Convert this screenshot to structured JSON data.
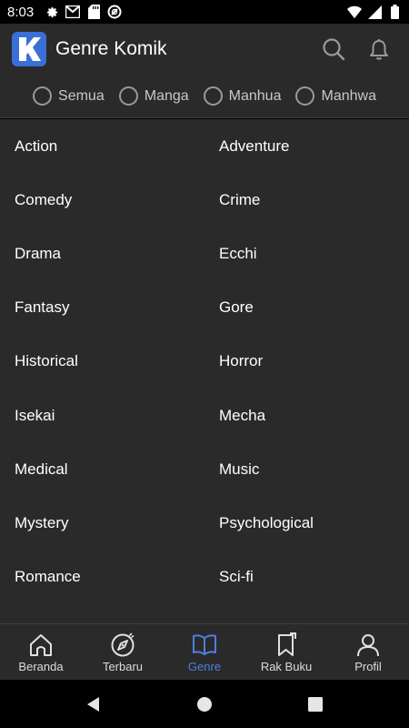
{
  "status_bar": {
    "time": "8:03",
    "left_icons": [
      "gear-icon",
      "gmail-icon",
      "sd-card-icon",
      "vpn-icon"
    ],
    "right_icons": [
      "wifi-icon",
      "signal-icon",
      "battery-icon"
    ]
  },
  "app_bar": {
    "logo_letter": "K",
    "title": "Genre Komik",
    "actions": [
      "search-icon",
      "bell-icon"
    ]
  },
  "filters": [
    {
      "label": "Semua",
      "selected": false
    },
    {
      "label": "Manga",
      "selected": false
    },
    {
      "label": "Manhua",
      "selected": false
    },
    {
      "label": "Manhwa",
      "selected": false
    }
  ],
  "genres": [
    [
      "Action",
      "Adventure"
    ],
    [
      "Comedy",
      "Crime"
    ],
    [
      "Drama",
      "Ecchi"
    ],
    [
      "Fantasy",
      "Gore"
    ],
    [
      "Historical",
      "Horror"
    ],
    [
      "Isekai",
      "Mecha"
    ],
    [
      "Medical",
      "Music"
    ],
    [
      "Mystery",
      "Psychological"
    ],
    [
      "Romance",
      "Sci-fi"
    ]
  ],
  "bottom_nav": [
    {
      "label": "Beranda",
      "icon": "home-icon",
      "active": false
    },
    {
      "label": "Terbaru",
      "icon": "compass-icon",
      "active": false
    },
    {
      "label": "Genre",
      "icon": "book-open-icon",
      "active": true
    },
    {
      "label": "Rak Buku",
      "icon": "bookmark-icon",
      "active": false
    },
    {
      "label": "Profil",
      "icon": "user-icon",
      "active": false
    }
  ],
  "colors": {
    "background": "#2a2a2a",
    "accent": "#4f7fe0",
    "logo": "#3a6fd8",
    "text": "#ffffff"
  }
}
